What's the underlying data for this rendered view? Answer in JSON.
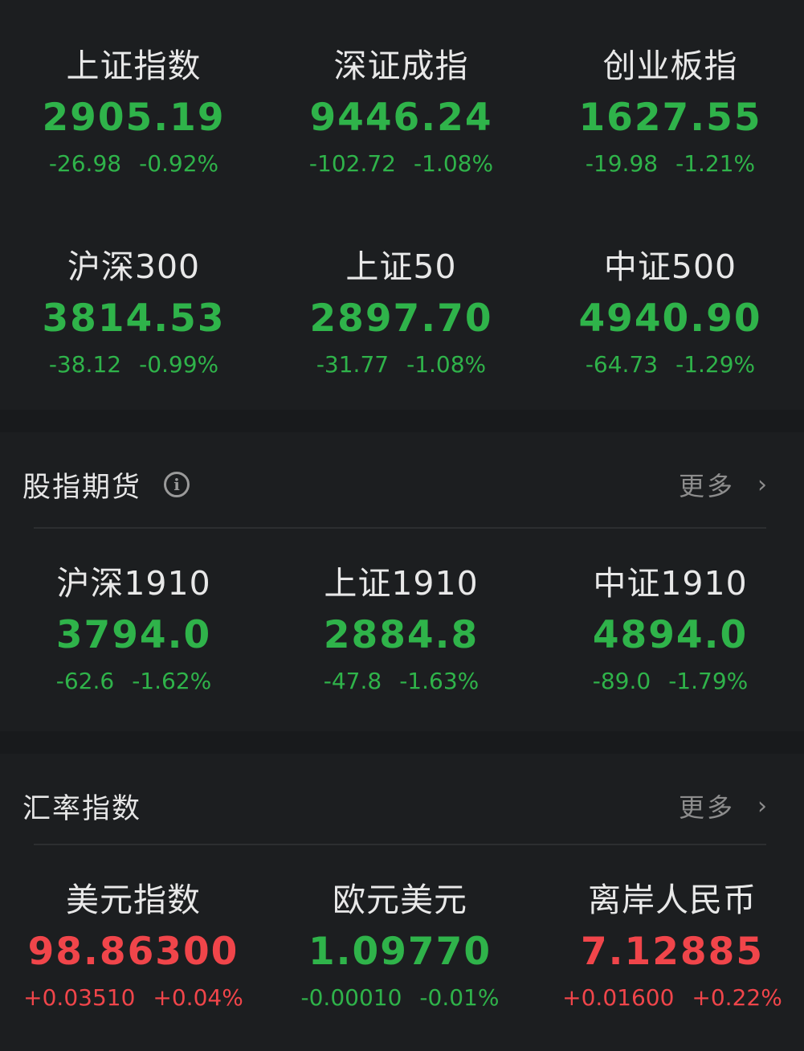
{
  "indices": [
    {
      "name": "上证指数",
      "price": "2905.19",
      "change": "-26.98",
      "pct": "-0.92%",
      "trend": "down"
    },
    {
      "name": "深证成指",
      "price": "9446.24",
      "change": "-102.72",
      "pct": "-1.08%",
      "trend": "down"
    },
    {
      "name": "创业板指",
      "price": "1627.55",
      "change": "-19.98",
      "pct": "-1.21%",
      "trend": "down"
    },
    {
      "name": "沪深300",
      "price": "3814.53",
      "change": "-38.12",
      "pct": "-0.99%",
      "trend": "down"
    },
    {
      "name": "上证50",
      "price": "2897.70",
      "change": "-31.77",
      "pct": "-1.08%",
      "trend": "down"
    },
    {
      "name": "中证500",
      "price": "4940.90",
      "change": "-64.73",
      "pct": "-1.29%",
      "trend": "down"
    }
  ],
  "futures": {
    "title": "股指期货",
    "info_icon": "info-circle-icon",
    "more_label": "更多",
    "more_icon": "chevron-right-icon",
    "items": [
      {
        "name": "沪深1910",
        "price": "3794.0",
        "change": "-62.6",
        "pct": "-1.62%",
        "trend": "down"
      },
      {
        "name": "上证1910",
        "price": "2884.8",
        "change": "-47.8",
        "pct": "-1.63%",
        "trend": "down"
      },
      {
        "name": "中证1910",
        "price": "4894.0",
        "change": "-89.0",
        "pct": "-1.79%",
        "trend": "down"
      }
    ]
  },
  "forex": {
    "title": "汇率指数",
    "more_label": "更多",
    "more_icon": "chevron-right-icon",
    "items": [
      {
        "name": "美元指数",
        "price": "98.86300",
        "change": "+0.03510",
        "pct": "+0.04%",
        "trend": "up"
      },
      {
        "name": "欧元美元",
        "price": "1.09770",
        "change": "-0.00010",
        "pct": "-0.01%",
        "trend": "down"
      },
      {
        "name": "离岸人民币",
        "price": "7.12885",
        "change": "+0.01600",
        "pct": "+0.22%",
        "trend": "up"
      }
    ]
  },
  "colors": {
    "up": "#f0454a",
    "down": "#2fb34a",
    "background": "#181a1c",
    "panel": "#1c1e20"
  }
}
